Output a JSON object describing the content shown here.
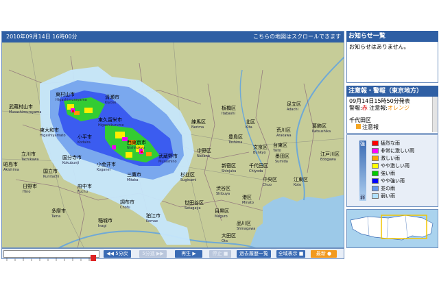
{
  "map": {
    "timestamp": "2010年09月14日 16時00分",
    "scroll_notice": "こちらの地図はスクロールできます",
    "places": [
      {
        "name": "東村山市",
        "romaji": "Higashimurayama"
      },
      {
        "name": "清瀬市",
        "romaji": "Kiyose"
      },
      {
        "name": "東久留米市",
        "romaji": "Higashikurume"
      },
      {
        "name": "小平市",
        "romaji": "Kodaira"
      },
      {
        "name": "武蔵村山市",
        "romaji": "Musashimurayama"
      },
      {
        "name": "東大和市",
        "romaji": "Higashiyamato"
      },
      {
        "name": "立川市",
        "romaji": "Tachikawa"
      },
      {
        "name": "国分寺市",
        "romaji": "Kokubunji"
      },
      {
        "name": "小金井市",
        "romaji": "Koganei"
      },
      {
        "name": "西東京市",
        "romaji": "Nishitokyo"
      },
      {
        "name": "武蔵野市",
        "romaji": "Musashino"
      },
      {
        "name": "三鷹市",
        "romaji": "Mitaka"
      },
      {
        "name": "府中市",
        "romaji": "Fuchu"
      },
      {
        "name": "調布市",
        "romaji": "Chofu"
      },
      {
        "name": "狛江市",
        "romaji": "Komae"
      },
      {
        "name": "日野市",
        "romaji": "Hino"
      },
      {
        "name": "多摩市",
        "romaji": "Tama"
      },
      {
        "name": "稲城市",
        "romaji": "Inagi"
      },
      {
        "name": "国立市",
        "romaji": "Kunitachi"
      },
      {
        "name": "昭島市",
        "romaji": "Akishima"
      },
      {
        "name": "練馬区",
        "romaji": "Nerima"
      },
      {
        "name": "板橋区",
        "romaji": "Itabashi"
      },
      {
        "name": "北区",
        "romaji": "Kita"
      },
      {
        "name": "足立区",
        "romaji": "Adachi"
      },
      {
        "name": "荒川区",
        "romaji": "Arakawa"
      },
      {
        "name": "豊島区",
        "romaji": "Toshima"
      },
      {
        "name": "文京区",
        "romaji": "Bunkyo"
      },
      {
        "name": "台東区",
        "romaji": "Taito"
      },
      {
        "name": "墨田区",
        "romaji": "Sumida"
      },
      {
        "name": "葛飾区",
        "romaji": "Katsushika"
      },
      {
        "name": "江戸川区",
        "romaji": "Edogawa"
      },
      {
        "name": "中野区",
        "romaji": "Nakano"
      },
      {
        "name": "新宿区",
        "romaji": "Shinjuku"
      },
      {
        "name": "千代田区",
        "romaji": "Chiyoda"
      },
      {
        "name": "中央区",
        "romaji": "Chuo"
      },
      {
        "name": "江東区",
        "romaji": "Koto"
      },
      {
        "name": "杉並区",
        "romaji": "Suginami"
      },
      {
        "name": "渋谷区",
        "romaji": "Shibuya"
      },
      {
        "name": "港区",
        "romaji": "Minato"
      },
      {
        "name": "世田谷区",
        "romaji": "Setagaya"
      },
      {
        "name": "目黒区",
        "romaji": "Meguro"
      },
      {
        "name": "品川区",
        "romaji": "Shinagawa"
      },
      {
        "name": "大田区",
        "romaji": "Ota"
      }
    ]
  },
  "controls": {
    "back_5min": "5分戻",
    "forward_5min": "5分進",
    "play": "再生",
    "stop": "停止",
    "history": "過去履歴一覧",
    "fullscreen": "全域表示",
    "end": "最新"
  },
  "notice_panel": {
    "title": "お知らせ一覧",
    "body": "お知らせはありません。"
  },
  "warning_panel": {
    "title": "注意報・警報（東京地方）",
    "issued": "09月14日15時50分発表",
    "warning_prefix": "警報:",
    "warning_red": "赤",
    "advisory_prefix": " 注意報:",
    "advisory_orange": "オレンジ",
    "area": "千代田区",
    "area_status": "注意報"
  },
  "legend": {
    "strong_label": "強",
    "weak_label": "弱",
    "colors": [
      "#ff0000",
      "#ff00ff",
      "#ffa500",
      "#ffff00",
      "#00cc00",
      "#0000ff",
      "#6495ed",
      "#b0e0ff"
    ],
    "items": [
      "猛烈な雨",
      "非常に激しい雨",
      "激しい雨",
      "やや激しい雨",
      "強い雨",
      "やや強い雨",
      "並の雨",
      "弱い雨"
    ]
  }
}
